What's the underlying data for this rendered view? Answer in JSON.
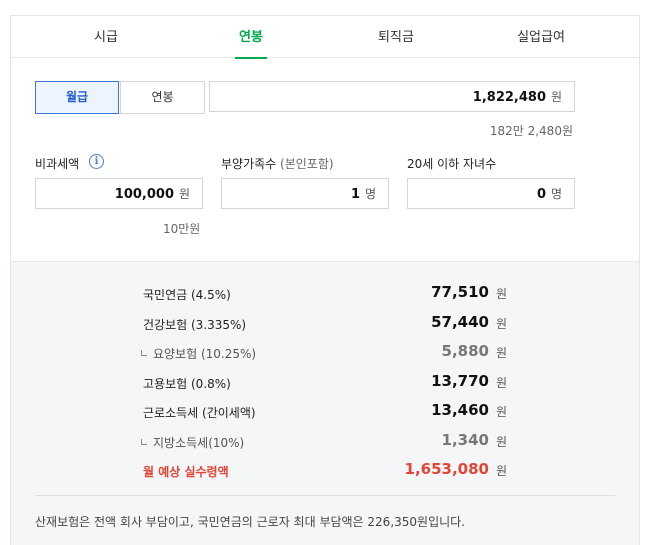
{
  "tabs": [
    {
      "label": "시급",
      "active": false
    },
    {
      "label": "연봉",
      "active": true
    },
    {
      "label": "퇴직금",
      "active": false
    },
    {
      "label": "실업급여",
      "active": false
    }
  ],
  "pay_toggle": {
    "selected": "월급",
    "other": "연봉"
  },
  "salary": {
    "value": "1,822,480",
    "unit": "원",
    "hint": "182만 2,480원"
  },
  "nontaxable": {
    "label": "비과세액",
    "info_icon": "info-icon",
    "value": "100,000",
    "unit": "원",
    "hint": "10만원"
  },
  "dependents": {
    "label": "부양가족수",
    "label_note": "(본인포함)",
    "value": "1",
    "unit": "명"
  },
  "children": {
    "label": "20세 이하 자녀수",
    "value": "0",
    "unit": "명"
  },
  "results": [
    {
      "label": "국민연금 (4.5%)",
      "value": "77,510",
      "unit": "원",
      "sub": false
    },
    {
      "label": "건강보험 (3.335%)",
      "value": "57,440",
      "unit": "원",
      "sub": false
    },
    {
      "label": "요양보험 (10.25%)",
      "value": "5,880",
      "unit": "원",
      "sub": true
    },
    {
      "label": "고용보험 (0.8%)",
      "value": "13,770",
      "unit": "원",
      "sub": false
    },
    {
      "label": "근로소득세 (간이세액)",
      "value": "13,460",
      "unit": "원",
      "sub": false
    },
    {
      "label": "지방소득세(10%)",
      "value": "1,340",
      "unit": "원",
      "sub": true
    }
  ],
  "total": {
    "label": "월 예상 실수령액",
    "value": "1,653,080",
    "unit": "원"
  },
  "note": "산재보험은 전액 회사 부담이고, 국민연금의 근로자 최대 부담액은 226,350원입니다.",
  "colors": {
    "accent_green": "#03a94d",
    "accent_blue": "#1f5fd1",
    "total_red": "#e24436"
  }
}
